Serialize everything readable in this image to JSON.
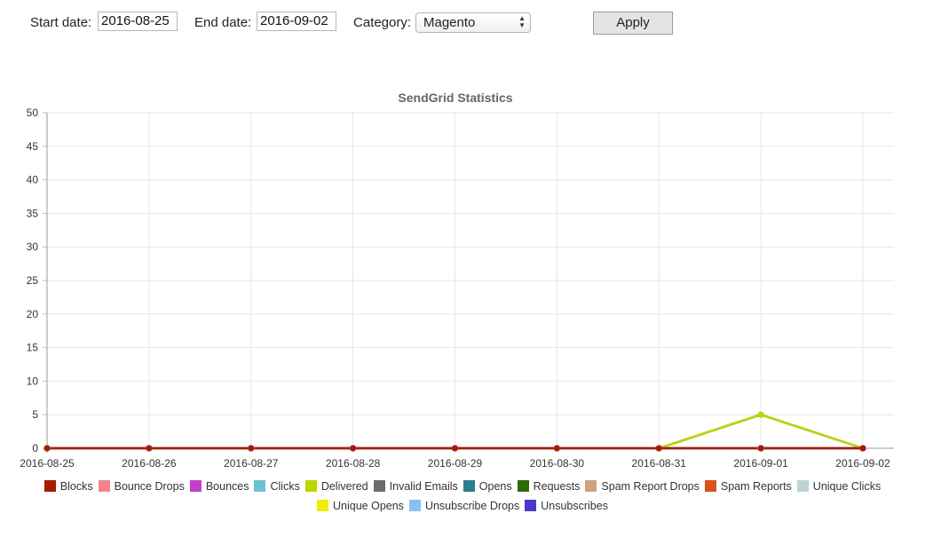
{
  "filters": {
    "start_label": "Start date:",
    "start_value": "2016-08-25",
    "end_label": "End date:",
    "end_value": "2016-09-02",
    "category_label": "Category:",
    "category_value": "Magento",
    "apply_label": "Apply"
  },
  "chart_data": {
    "type": "line",
    "title": "SendGrid Statistics",
    "xlabel": "",
    "ylabel": "",
    "ylim": [
      0,
      50
    ],
    "yticks": [
      0,
      5,
      10,
      15,
      20,
      25,
      30,
      35,
      40,
      45,
      50
    ],
    "grid": true,
    "legend_position": "bottom",
    "x": [
      "2016-08-25",
      "2016-08-26",
      "2016-08-27",
      "2016-08-28",
      "2016-08-29",
      "2016-08-30",
      "2016-08-31",
      "2016-09-01",
      "2016-09-02"
    ],
    "series": [
      {
        "name": "Blocks",
        "color": "#a61c00",
        "values": [
          0,
          0,
          0,
          0,
          0,
          0,
          0,
          0,
          0
        ]
      },
      {
        "name": "Bounce Drops",
        "color": "#f4828f",
        "values": [
          0,
          0,
          0,
          0,
          0,
          0,
          0,
          0,
          0
        ]
      },
      {
        "name": "Bounces",
        "color": "#c23fc7",
        "values": [
          0,
          0,
          0,
          0,
          0,
          0,
          0,
          0,
          0
        ]
      },
      {
        "name": "Clicks",
        "color": "#6fc0d0",
        "values": [
          0,
          0,
          0,
          0,
          0,
          0,
          0,
          0,
          0
        ]
      },
      {
        "name": "Delivered",
        "color": "#bcd600",
        "values": [
          0,
          0,
          0,
          0,
          0,
          0,
          0,
          5,
          0
        ]
      },
      {
        "name": "Invalid Emails",
        "color": "#6b6b6b",
        "values": [
          0,
          0,
          0,
          0,
          0,
          0,
          0,
          0,
          0
        ]
      },
      {
        "name": "Opens",
        "color": "#2b7f8c",
        "values": [
          0,
          0,
          0,
          0,
          0,
          0,
          0,
          0,
          0
        ]
      },
      {
        "name": "Requests",
        "color": "#2c6b06",
        "values": [
          0,
          0,
          0,
          0,
          0,
          0,
          0,
          5,
          0
        ]
      },
      {
        "name": "Spam Report Drops",
        "color": "#cea27a",
        "values": [
          0,
          0,
          0,
          0,
          0,
          0,
          0,
          0,
          0
        ]
      },
      {
        "name": "Spam Reports",
        "color": "#d9531e",
        "values": [
          0,
          0,
          0,
          0,
          0,
          0,
          0,
          0,
          0
        ]
      },
      {
        "name": "Unique Clicks",
        "color": "#bfd3d5",
        "values": [
          0,
          0,
          0,
          0,
          0,
          0,
          0,
          0,
          0
        ]
      },
      {
        "name": "Unique Opens",
        "color": "#f2ec00",
        "values": [
          0,
          0,
          0,
          0,
          0,
          0,
          0,
          0,
          0
        ]
      },
      {
        "name": "Unsubscribe Drops",
        "color": "#8cc0f5",
        "values": [
          0,
          0,
          0,
          0,
          0,
          0,
          0,
          0,
          0
        ]
      },
      {
        "name": "Unsubscribes",
        "color": "#4a39d0",
        "values": [
          0,
          0,
          0,
          0,
          0,
          0,
          0,
          0,
          0
        ]
      }
    ]
  }
}
